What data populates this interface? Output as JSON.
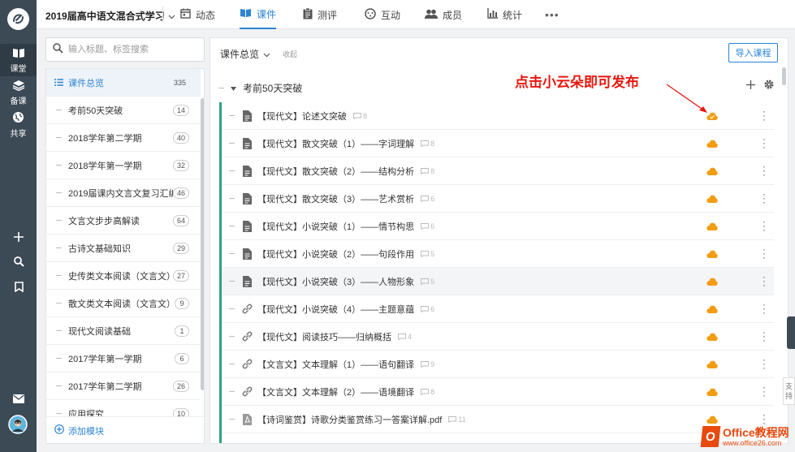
{
  "rail": {
    "items": [
      {
        "label": "课堂",
        "icon": "book-icon"
      },
      {
        "label": "备课",
        "icon": "layers-icon"
      },
      {
        "label": "共享",
        "icon": "globe-icon"
      }
    ],
    "tools": [
      "plus-icon",
      "search-icon",
      "bookmark-icon"
    ],
    "bottom": [
      "mail-icon",
      "avatar"
    ]
  },
  "topbar": {
    "course_title": "2019届高中语文混合式学习",
    "tabs": [
      {
        "label": "动态",
        "icon": "calendar-icon"
      },
      {
        "label": "课件",
        "icon": "book-open-icon",
        "active": true
      },
      {
        "label": "测评",
        "icon": "clipboard-icon"
      },
      {
        "label": "互动",
        "icon": "chat-face-icon"
      },
      {
        "label": "成员",
        "icon": "people-icon"
      },
      {
        "label": "统计",
        "icon": "bar-chart-icon"
      }
    ],
    "more": "•••"
  },
  "sidebar": {
    "search_placeholder": "输入标题、标签搜索",
    "header": {
      "label": "课件总览",
      "count": "335"
    },
    "modules": [
      {
        "label": "考前50天突破",
        "count": "14"
      },
      {
        "label": "2018学年第二学期",
        "count": "40"
      },
      {
        "label": "2018学年第一学期",
        "count": "32"
      },
      {
        "label": "2019届课内文言文复习汇编",
        "count": "46"
      },
      {
        "label": "文言文步步高解读",
        "count": "64"
      },
      {
        "label": "古诗文基础知识",
        "count": "29"
      },
      {
        "label": "史传类文本阅读（文言文）",
        "count": "27"
      },
      {
        "label": "散文类文本阅读（文言文）",
        "count": "9"
      },
      {
        "label": "现代文阅读基础",
        "count": "1"
      },
      {
        "label": "2017学年第一学期",
        "count": "6"
      },
      {
        "label": "2017学年第二学期",
        "count": "26"
      },
      {
        "label": "应用探究",
        "count": "10"
      }
    ],
    "add_module": "添加模块"
  },
  "main": {
    "overview_label": "课件总览",
    "collapse_label": "收起",
    "import_button": "导入课程",
    "section_title": "考前50天突破",
    "annotation": "点击小云朵即可发布",
    "rows": [
      {
        "title": "【现代文】论述文突破",
        "comments": "8",
        "type": "doc"
      },
      {
        "title": "【现代文】散文突破（1）——字词理解",
        "comments": "8",
        "type": "doc"
      },
      {
        "title": "【现代文】散文突破（2）——结构分析",
        "comments": "8",
        "type": "doc"
      },
      {
        "title": "【现代文】散文突破（3）——艺术赏析",
        "comments": "6",
        "type": "doc"
      },
      {
        "title": "【现代文】小说突破（1）——情节构思",
        "comments": "6",
        "type": "doc"
      },
      {
        "title": "【现代文】小说突破（2）——句段作用",
        "comments": "5",
        "type": "doc"
      },
      {
        "title": "【现代文】小说突破（3）——人物形象",
        "comments": "5",
        "type": "doc"
      },
      {
        "title": "【现代文】小说突破（4）——主题意蕴",
        "comments": "6",
        "type": "link"
      },
      {
        "title": "【现代文】阅读技巧——归纳概括",
        "comments": "4",
        "type": "link"
      },
      {
        "title": "【文言文】文本理解（1）——语句翻译",
        "comments": "9",
        "type": "link"
      },
      {
        "title": "【文言文】文本理解（2）——语境翻译",
        "comments": "8",
        "type": "link"
      },
      {
        "title": "【诗词鉴赏】诗歌分类鉴赏练习一答案详解.pdf",
        "comments": "11",
        "type": "pdf"
      }
    ]
  },
  "support_label": [
    "支",
    "持"
  ],
  "watermark": {
    "line1": "Office教程网",
    "line2": "www.office26.com"
  },
  "colors": {
    "accent": "#2b84d3",
    "rail": "#3c4a56",
    "cloud": "#f39c12",
    "annotation": "#e8170f",
    "row_marker": "#2fa37a"
  }
}
